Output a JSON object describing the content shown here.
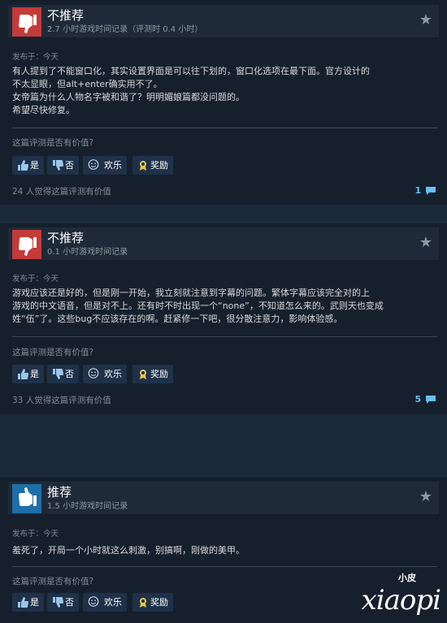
{
  "reviews": [
    {
      "verdict": "不推荐",
      "hours": "2.7 小时游戏时间记录（评测时 0.4 小时）",
      "posted": "发布于：今天",
      "lines": [
        "有人提到了不能窗口化，其实设置界面是可以往下划的，窗口化选项在最下面。官方设计的",
        "不太显眼，但alt+enter确实用不了。",
        "女帝篇为什么人物名字被和谐了？明明媚娘篇都没问题的。",
        "希望尽快修复。"
      ],
      "helpful_question": "这篇评测是否有价值?",
      "buttons": {
        "yes": "是",
        "no": "否",
        "funny": "欢乐",
        "award": "奖励"
      },
      "helpful_count": "24 人觉得这篇评测有价值",
      "comments": "1"
    },
    {
      "verdict": "不推荐",
      "hours": "0.1 小时游戏时间记录",
      "posted": "发布于：今天",
      "lines": [
        "游戏应该还是好的，但是刚一开始，我立刻就注意到字幕的问题。繁体字幕应该完全对的上",
        "游戏的中文语音，但是对不上。还有时不时出现一个“none”，不知道怎么来的。武则天也变成",
        "姓“伍”了。这些bug不应该存在的啊。赶紧修一下吧，很分散注意力，影响体验感。"
      ],
      "helpful_question": "这篇评测是否有价值?",
      "buttons": {
        "yes": "是",
        "no": "否",
        "funny": "欢乐",
        "award": "奖励"
      },
      "helpful_count": "33 人觉得这篇评测有价值",
      "comments": "5"
    },
    {
      "verdict": "推荐",
      "hours": "1.5 小时游戏时间记录",
      "posted": "发布于：今天",
      "lines": [
        "羞死了，开局一个小时就这么刺激，别搞啊，刚做的美甲。"
      ],
      "helpful_question": "这篇评测是否有价值?",
      "buttons": {
        "yes": "是",
        "no": "否",
        "funny": "欢乐",
        "award": "奖励"
      }
    }
  ],
  "watermark": {
    "small": "小皮",
    "big": "xiaopi"
  },
  "colors": {
    "negative": "#c33a39",
    "positive": "#1e6ea7",
    "link": "#66c0f4"
  }
}
